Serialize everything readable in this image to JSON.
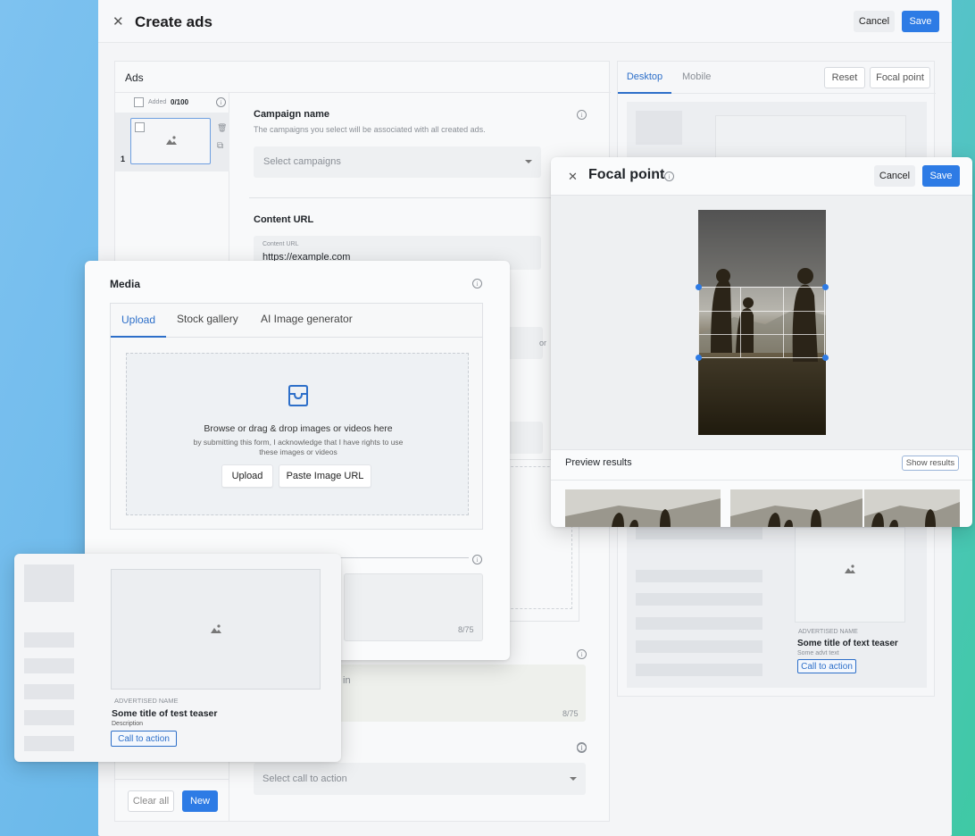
{
  "header": {
    "title": "Create ads",
    "cancel_label": "Cancel",
    "save_label": "Save"
  },
  "ads_panel": {
    "title": "Ads",
    "added_label": "Added",
    "added_count": "0/100",
    "item_number": "1",
    "clear_all_label": "Clear all",
    "new_label": "New"
  },
  "form": {
    "campaign_title": "Campaign name",
    "campaign_desc": "The campaigns you select will be associated with all created ads.",
    "campaign_placeholder": "Select campaigns",
    "content_url_title": "Content URL",
    "content_url_label": "Content URL",
    "content_url_value": "https://example.com",
    "partial_label_or": "or",
    "partial_in": "in",
    "counter_1": "8/75",
    "counter_2": "8/75",
    "cta_placeholder": "Select call to action"
  },
  "preview": {
    "tabs": [
      "Desktop",
      "Mobile"
    ],
    "reset_label": "Reset",
    "focal_point_label": "Focal point",
    "advertised_name": "ADVERTISED NAME",
    "title": "Some title of text teaser",
    "description": "Some advt text",
    "cta": "Call to action"
  },
  "media": {
    "title": "Media",
    "tabs": [
      "Upload",
      "Stock gallery",
      "AI Image generator"
    ],
    "drop_title": "Browse or drag & drop images or videos here",
    "drop_desc": "by submitting this form, I acknowledge that I have rights to use these images or videos",
    "upload_label": "Upload",
    "paste_label": "Paste Image URL"
  },
  "focal": {
    "title": "Focal point",
    "cancel_label": "Cancel",
    "save_label": "Save",
    "preview_results_label": "Preview results",
    "show_results_label": "Show results"
  },
  "teaser": {
    "advertised_name": "ADVERTISED NAME",
    "title": "Some title of test teaser",
    "description": "Description",
    "cta": "Call to action"
  },
  "colors": {
    "accent": "#2d7be5",
    "link": "#2d6fc9"
  }
}
